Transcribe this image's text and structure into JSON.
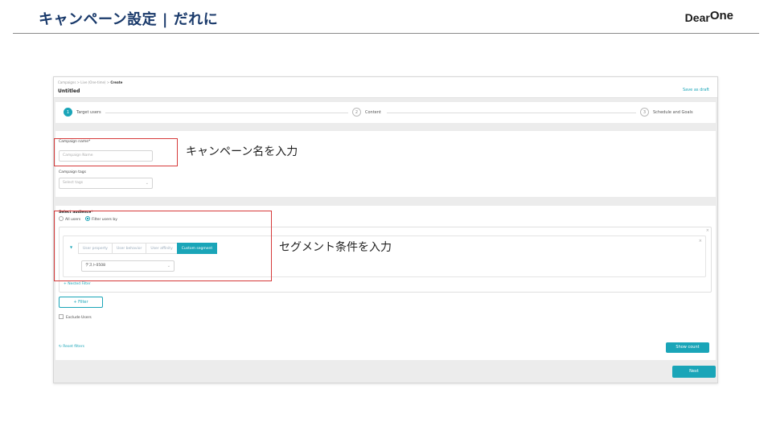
{
  "slide": {
    "title": "キャンペーン設定 | だれに",
    "logo_main": "Dear",
    "logo_super": "One"
  },
  "app": {
    "breadcrumb": {
      "trail": "Campaigns > Live (One-time) > ",
      "current": "Create"
    },
    "page_name": "Untitled",
    "save_draft_label": "Save as draft",
    "steps": [
      {
        "number": "1",
        "label": "Target users",
        "active": true
      },
      {
        "number": "2",
        "label": "Content",
        "active": false
      },
      {
        "number": "3",
        "label": "Schedule and Goals",
        "active": false
      }
    ],
    "campaign_name": {
      "label": "Campaign name*",
      "placeholder": "Campaign Name"
    },
    "campaign_tags": {
      "label": "Campaign tags",
      "placeholder": "Select tags"
    },
    "audience": {
      "label": "Select audience*",
      "options": [
        {
          "label": "All users",
          "checked": false
        },
        {
          "label": "Filter users by",
          "checked": true
        }
      ],
      "tabs": [
        {
          "label": "User property",
          "active": false
        },
        {
          "label": "User behavior",
          "active": false
        },
        {
          "label": "User affinity",
          "active": false
        },
        {
          "label": "Custom segment",
          "active": true
        }
      ],
      "segment_value": "テスト0508",
      "nested_filter_label": "+ Nested Filter",
      "filter_button_label": "+ Filter",
      "exclude_users_label": "Exclude Users",
      "reset_filters_label": "Reset filters",
      "show_count_label": "Show count"
    },
    "next_label": "Next"
  },
  "annotations": {
    "campaign_name_callout": "キャンペーン名を入力",
    "segment_callout": "セグメント条件を入力"
  },
  "colors": {
    "accent": "#1aa5b8",
    "highlight": "#d63a3a",
    "title": "#1a3a6b"
  },
  "icons": {
    "caret": "caret-down-icon",
    "chevron": "chevron-down-icon",
    "close": "close-icon",
    "reset": "refresh-icon"
  }
}
